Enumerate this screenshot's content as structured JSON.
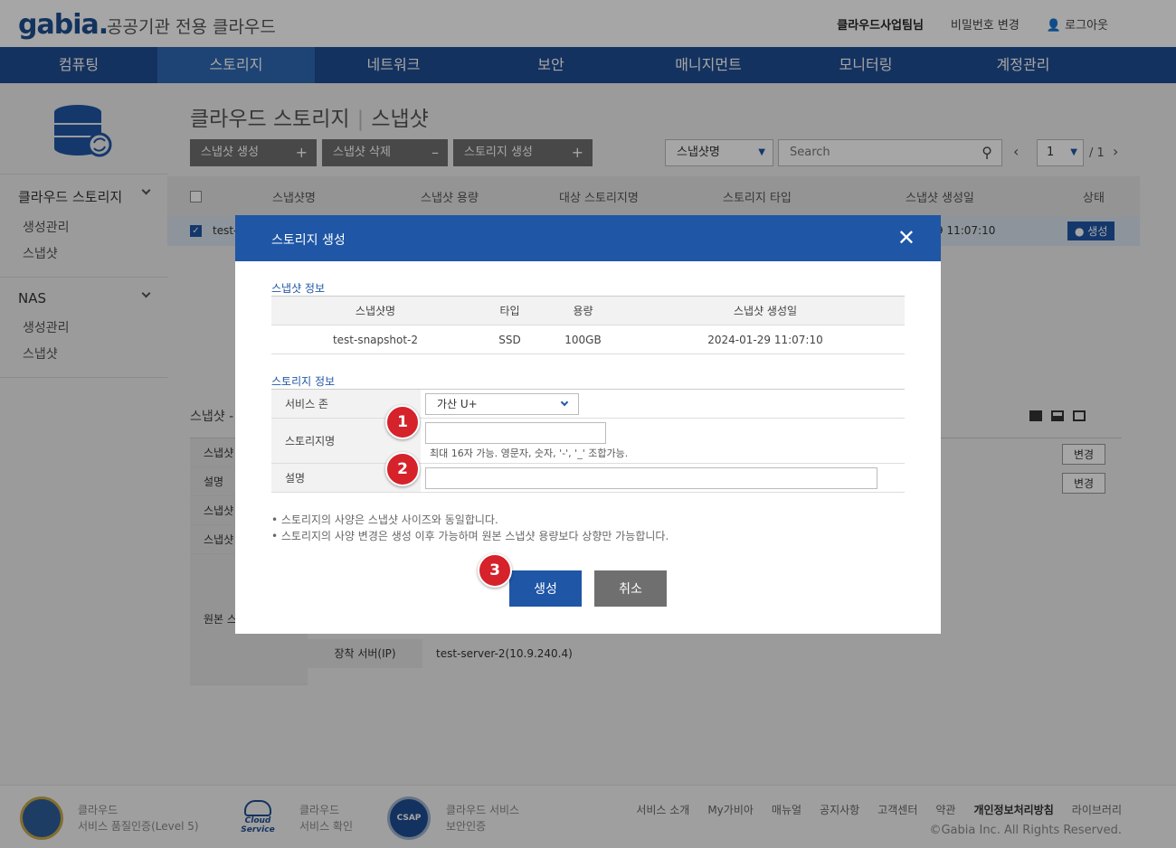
{
  "header": {
    "logo": "gabia.",
    "subtitle": "공공기관 전용 클라우드",
    "user": "클라우드사업팀님",
    "change_password": "비밀번호 변경",
    "logout": "로그아웃"
  },
  "nav": [
    "컴퓨팅",
    "스토리지",
    "네트워크",
    "보안",
    "매니지먼트",
    "모니터링",
    "계정관리"
  ],
  "sidebar": {
    "groups": [
      {
        "title": "클라우드 스토리지",
        "items": [
          "생성관리",
          "스냅샷"
        ]
      },
      {
        "title": "NAS",
        "items": [
          "생성관리",
          "스냅샷"
        ]
      }
    ]
  },
  "page": {
    "title": "클라우드 스토리지",
    "subtitle": "스냅샷"
  },
  "toolbar": {
    "create_snapshot": "스냅샷 생성",
    "delete_snapshot": "스냅샷 삭제",
    "create_storage": "스토리지 생성",
    "search_select": "스냅샷명",
    "search_placeholder": "Search",
    "page_current": "1",
    "page_total": "/ 1"
  },
  "grid": {
    "headers": [
      "스냅샷명",
      "스냅샷 용량",
      "대상 스토리지명",
      "스토리지 타입",
      "스냅샷 생성일",
      "상태"
    ],
    "row": {
      "name": "test-",
      "date": "9 11:07:10",
      "status": "생성"
    }
  },
  "detail": {
    "title": "스냅샷 -",
    "labels": [
      "스냅샷",
      "설명",
      "스냅샷",
      "스냅샷",
      "원본 스"
    ],
    "change": "변경",
    "server_label": "장착 서버(IP)",
    "server_value": "test-server-2(10.9.240.4)"
  },
  "modal": {
    "title": "스토리지 생성",
    "snapshot_section": "스냅샷 정보",
    "snapshot_headers": [
      "스냅샷명",
      "타입",
      "용량",
      "스냅샷 생성일"
    ],
    "snapshot_row": [
      "test-snapshot-2",
      "SSD",
      "100GB",
      "2024-01-29 11:07:10"
    ],
    "storage_section": "스토리지 정보",
    "zone_label": "서비스 존",
    "zone_value": "가산 U+",
    "name_label": "스토리지명",
    "name_value": "",
    "name_hint": "최대 16자 가능. 영문자, 숫자, '-', '_' 조합가능.",
    "desc_label": "설명",
    "desc_value": "",
    "notes": [
      "• 스토리지의 사양은 스냅샷 사이즈와 동일합니다.",
      "• 스토리지의 사양 변경은 생성 이후 가능하며 원본 스냅샷 용량보다 상향만 가능합니다."
    ],
    "create": "생성",
    "cancel": "취소"
  },
  "badges": [
    "1",
    "2",
    "3"
  ],
  "footer": {
    "certs": [
      {
        "line1": "클라우드",
        "line2": "서비스 품질인증(Level 5)"
      },
      {
        "line1": "클라우드",
        "line2": "서비스 확인"
      },
      {
        "line1": "클라우드 서비스",
        "line2": "보안인증"
      }
    ],
    "links": [
      "서비스 소개",
      "My가비아",
      "매뉴얼",
      "공지사항",
      "고객센터",
      "약관",
      "개인정보처리방침",
      "라이브러리"
    ],
    "copyright": "©Gabia Inc. All Rights Reserved.",
    "logo_text": {
      "cloud_service": "Cloud Service",
      "csap": "CSAP"
    }
  },
  "colors": {
    "primary": "#1f56a6",
    "nav": "#1f4e92",
    "badge": "#d5222b"
  }
}
